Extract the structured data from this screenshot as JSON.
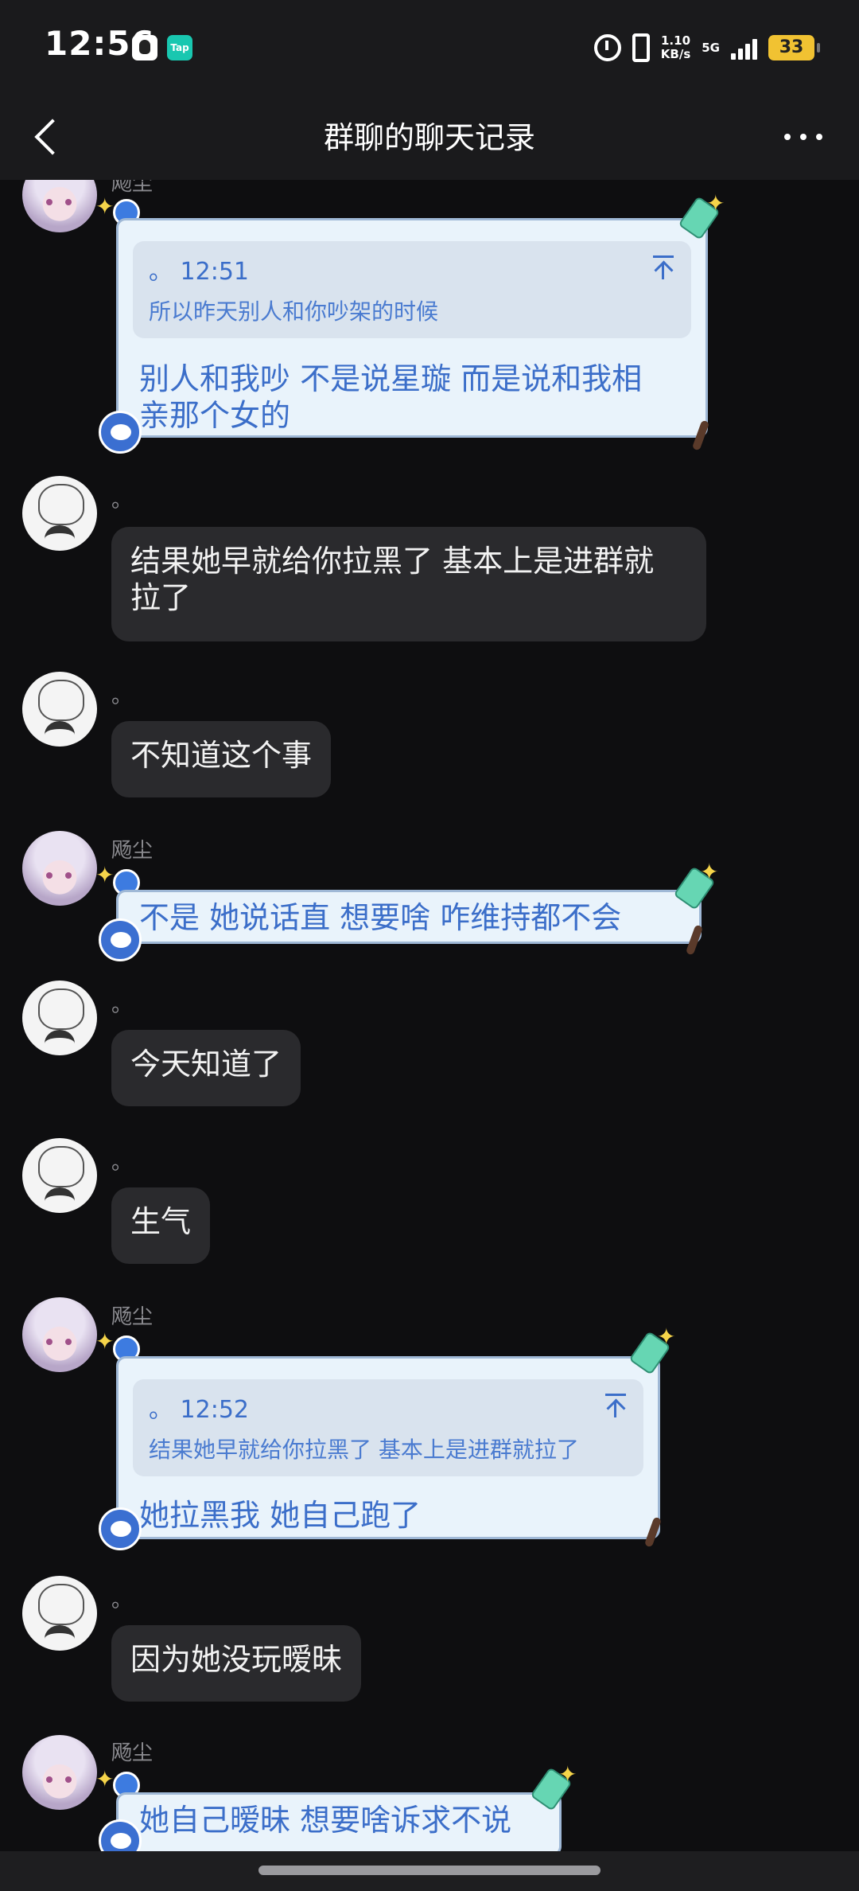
{
  "status_bar": {
    "time": "12:56",
    "tap_label": "Tap",
    "net_speed": "1.10",
    "net_speed_unit": "KB/s",
    "network": "5G",
    "battery": "33"
  },
  "nav": {
    "title": "群聊的聊天记录"
  },
  "messages": [
    {
      "sender": "飏尘",
      "quote_sender_time": "。 12:51",
      "quote_text": "所以昨天别人和你吵架的时候",
      "text_line1": "别人和我吵  不是说星璇  而是说和我相",
      "text_line2": "亲那个女的"
    },
    {
      "sender": "。",
      "text_line1": "结果她早就给你拉黑了 基本上是进群就",
      "text_line2": "拉了"
    },
    {
      "sender": "。",
      "text": "不知道这个事"
    },
    {
      "sender": "飏尘",
      "text": "不是   她说话直  想要啥  咋维持都不会"
    },
    {
      "sender": "。",
      "text": "今天知道了"
    },
    {
      "sender": "。",
      "text": "生气"
    },
    {
      "sender": "飏尘",
      "quote_sender_time": "。 12:52",
      "quote_text": "结果她早就给你拉黑了 基本上是进群就拉了",
      "text": "她拉黑我  她自己跑了"
    },
    {
      "sender": "。",
      "text": "因为她没玩暧昧"
    },
    {
      "sender": "飏尘",
      "text": "她自己暧昧  想要啥诉求不说"
    }
  ]
}
